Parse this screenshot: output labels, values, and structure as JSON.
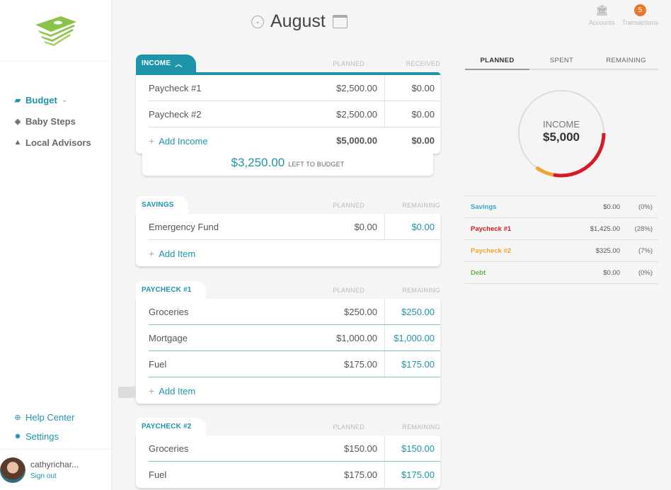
{
  "sidebar": {
    "nav": [
      {
        "label": "Budget",
        "icon": "folder-open-icon",
        "active": true
      },
      {
        "label": "Baby Steps",
        "icon": "steps-icon"
      },
      {
        "label": "Local Advisors",
        "icon": "person-icon"
      }
    ],
    "bottom": [
      {
        "label": "Help Center",
        "icon": "lifebuoy-icon"
      },
      {
        "label": "Settings",
        "icon": "gear-icon"
      }
    ],
    "user": {
      "name": "cathyrichar...",
      "sign_out": "Sign out"
    }
  },
  "header": {
    "month": "August"
  },
  "top_right": {
    "accounts_label": "Accounts",
    "transactions_label": "Transactions",
    "transactions_count": "5"
  },
  "income": {
    "title": "INCOME",
    "cols": [
      "PLANNED",
      "RECEIVED"
    ],
    "rows": [
      {
        "name": "Paycheck #1",
        "planned": "$2,500.00",
        "value": "$0.00"
      },
      {
        "name": "Paycheck #2",
        "planned": "$2,500.00",
        "value": "$0.00"
      }
    ],
    "add_label": "Add Income",
    "total_planned": "$5,000.00",
    "total_received": "$0.00",
    "left_amount": "$3,250.00",
    "left_label": "LEFT TO BUDGET"
  },
  "savings": {
    "title": "SAVINGS",
    "cols": [
      "PLANNED",
      "REMAINING"
    ],
    "rows": [
      {
        "name": "Emergency Fund",
        "planned": "$0.00",
        "value": "$0.00"
      }
    ],
    "add_label": "Add Item"
  },
  "paycheck1": {
    "title": "PAYCHECK #1",
    "cols": [
      "PLANNED",
      "REMAINING"
    ],
    "rows": [
      {
        "name": "Groceries",
        "planned": "$250.00",
        "value": "$250.00"
      },
      {
        "name": "Mortgage",
        "planned": "$1,000.00",
        "value": "$1,000.00"
      },
      {
        "name": "Fuel",
        "planned": "$175.00",
        "value": "$175.00"
      }
    ],
    "add_label": "Add Item"
  },
  "paycheck2": {
    "title": "PAYCHECK #2",
    "cols": [
      "PLANNED",
      "REMAINING"
    ],
    "rows": [
      {
        "name": "Groceries",
        "planned": "$150.00",
        "value": "$150.00"
      },
      {
        "name": "Fuel",
        "planned": "$175.00",
        "value": "$175.00"
      }
    ]
  },
  "right_panel": {
    "tabs": [
      "PLANNED",
      "SPENT",
      "REMAINING"
    ],
    "active_tab": 0,
    "donut_title": "INCOME",
    "donut_value": "$5,000",
    "segments": [
      {
        "name": "Savings",
        "amount": "$0.00",
        "pct": "(0%)",
        "fraction": 0,
        "color": "#3aa6c9"
      },
      {
        "name": "Paycheck #1",
        "amount": "$1,425.00",
        "pct": "(28%)",
        "fraction": 0.28,
        "color": "#d71a2a"
      },
      {
        "name": "Paycheck #2",
        "amount": "$325.00",
        "pct": "(7%)",
        "fraction": 0.07,
        "color": "#f0a431"
      },
      {
        "name": "Debt",
        "amount": "$0.00",
        "pct": "(0%)",
        "fraction": 0,
        "color": "#6ab04c"
      }
    ]
  },
  "colors": {
    "accent": "#1e94ab",
    "logo_green": "#8bc34a",
    "badge": "#e8772b"
  }
}
